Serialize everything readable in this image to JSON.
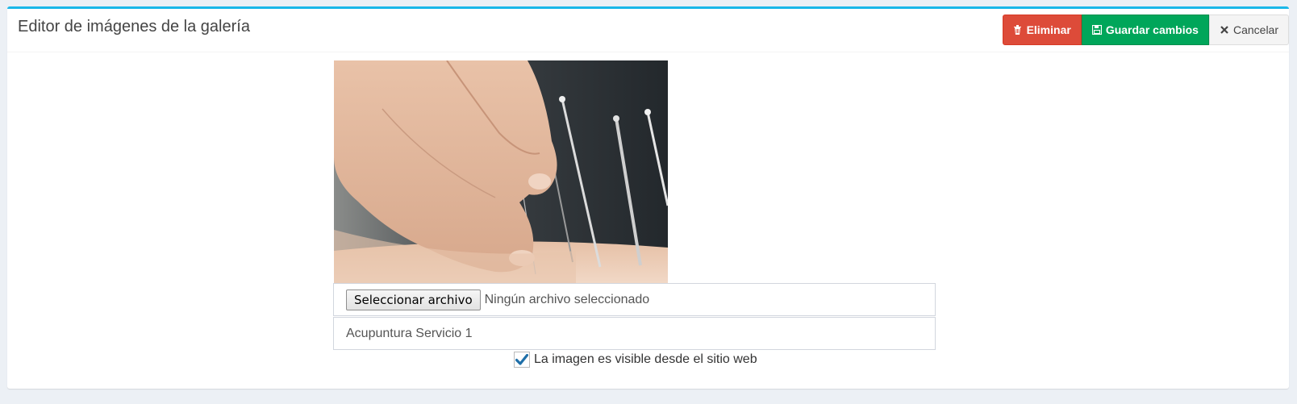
{
  "header": {
    "title": "Editor de imágenes de la galería",
    "delete_label": "Eliminar",
    "save_label": "Guardar cambios",
    "cancel_label": "Cancelar",
    "colors": {
      "accent": "#1ab7e8",
      "danger": "#dd4b39",
      "success": "#00a65a"
    }
  },
  "image": {
    "description": "Acupuncture needles being inserted by hand"
  },
  "file_input": {
    "button_label": "Seleccionar archivo",
    "status": "Ningún archivo seleccionado"
  },
  "caption": {
    "value": "Acupuntura Servicio 1"
  },
  "visibility": {
    "checked": true,
    "label": "La imagen es visible desde el sitio web"
  }
}
